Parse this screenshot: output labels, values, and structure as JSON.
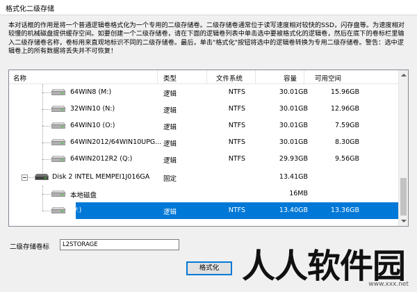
{
  "window": {
    "title": "格式化二级存储"
  },
  "description": "本对话框的作用是将一个普通逻辑卷格式化为一个专用的二级存储卷。二级存储卷通常位于读写速度相对较快的SSD，闪存盘等。为速度相对较慢的机械磁盘提供缓存空间。如要创建一个二级存储卷，请在下面的逻辑卷列表中单击选中要被格式化的逻辑卷，然后在底下的卷标栏里输入二级存储卷名称，卷标用来直观地标识不同的二级存储卷。最后，单击\"格式化\"按钮将选中的逻辑卷转换为专用二级存储卷。警告：选中逻辑卷上的所有数据将丢失并不可恢复！",
  "columns": [
    "名称",
    "类型",
    "文件系统",
    "容量",
    "可用空间"
  ],
  "rows": [
    {
      "name": "64WIN8 (M:)",
      "type": "逻辑",
      "fs": "NTFS",
      "capacity": "30.01GB",
      "free": "15.96GB"
    },
    {
      "name": "32WIN10 (N:)",
      "type": "逻辑",
      "fs": "NTFS",
      "capacity": "30.01GB",
      "free": "12.96GB"
    },
    {
      "name": "64WIN10 (O:)",
      "type": "逻辑",
      "fs": "NTFS",
      "capacity": "30.01GB",
      "free": "7.59GB"
    },
    {
      "name": "64WIN2012/64WIN10UPG...",
      "type": "逻辑",
      "fs": "NTFS",
      "capacity": "30.01GB",
      "free": "8.30GB"
    },
    {
      "name": "64WIN2012R2 (Q:)",
      "type": "逻辑",
      "fs": "NTFS",
      "capacity": "29.93GB",
      "free": "9.56GB"
    },
    {
      "name": "Disk 2 INTEL MEMPEI1J016GA",
      "type": "固定",
      "fs": "",
      "capacity": "13.41GB",
      "free": ""
    },
    {
      "name": "本地磁盘",
      "type": "",
      "fs": "",
      "capacity": "16MB",
      "free": ""
    },
    {
      "name": "(V:)",
      "type": "逻辑",
      "fs": "NTFS",
      "capacity": "13.40GB",
      "free": "13.36GB"
    }
  ],
  "label_field": {
    "label": "二级存储卷标",
    "value": "L2STORAGE"
  },
  "format_button": "格式化",
  "watermark": {
    "text": "人人软件园",
    "sub": "www.xxx.net"
  },
  "colors": {
    "selection": "#0078d7",
    "drive_icon": "#b0b0b0",
    "disk_icon": "#404040"
  }
}
